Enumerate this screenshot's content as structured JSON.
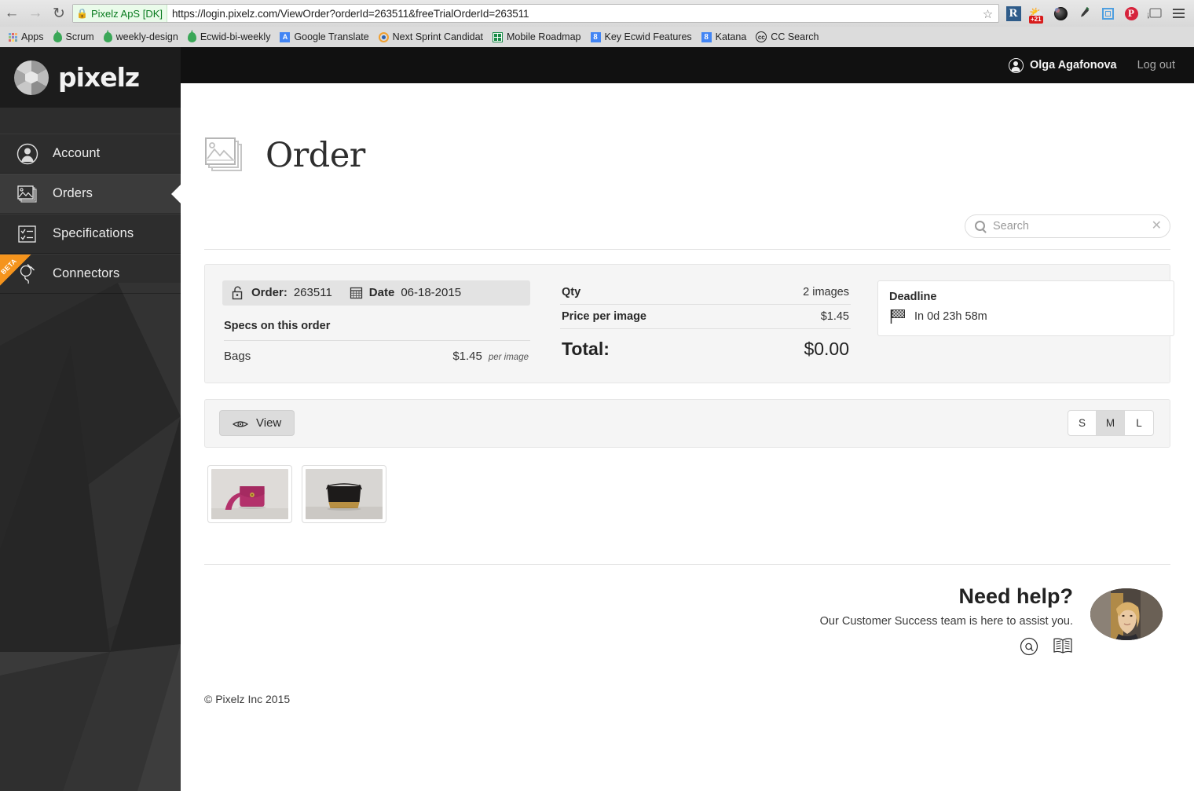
{
  "browser": {
    "back_icon": "back-arrow-icon",
    "forward_icon": "forward-arrow-icon",
    "reload_icon": "reload-icon",
    "site_chip": "Pixelz ApS [DK]",
    "url": "https://login.pixelz.com/ViewOrder?orderId=263511&freeTrialOrderId=263511",
    "star_icon": "bookmark-star-icon",
    "toolbar_icons": [
      {
        "name": "readability-extension-icon",
        "label": "R"
      },
      {
        "name": "weather-extension-icon",
        "label": "",
        "badge": "+21"
      },
      {
        "name": "camera-extension-icon",
        "label": ""
      },
      {
        "name": "eyedropper-extension-icon",
        "label": ""
      },
      {
        "name": "screenshot-extension-icon",
        "label": ""
      },
      {
        "name": "pinterest-extension-icon",
        "label": "P"
      },
      {
        "name": "cast-icon",
        "label": ""
      },
      {
        "name": "chrome-menu-icon",
        "label": ""
      }
    ],
    "bookmarks": [
      {
        "label": "Apps",
        "icon": "apps-grid-icon"
      },
      {
        "label": "Scrum",
        "icon": "green-drop-icon"
      },
      {
        "label": "weekly-design",
        "icon": "green-drop-icon"
      },
      {
        "label": "Ecwid-bi-weekly",
        "icon": "green-drop-icon"
      },
      {
        "label": "Google Translate",
        "icon": "google-translate-icon"
      },
      {
        "label": "Next Sprint Candidat",
        "icon": "target-icon"
      },
      {
        "label": "Mobile Roadmap",
        "icon": "spreadsheet-icon"
      },
      {
        "label": "Key Ecwid Features",
        "icon": "google-docs-icon"
      },
      {
        "label": "Katana",
        "icon": "google-docs-icon"
      },
      {
        "label": "CC Search",
        "icon": "creative-commons-icon"
      }
    ]
  },
  "sidebar": {
    "logo_text": "pixelz",
    "logo_icon": "pixelz-aperture-logo",
    "items": [
      {
        "label": "Account",
        "icon": "account-person-icon",
        "active": false,
        "beta": false
      },
      {
        "label": "Orders",
        "icon": "orders-images-icon",
        "active": true,
        "beta": false
      },
      {
        "label": "Specifications",
        "icon": "specifications-checklist-icon",
        "active": false,
        "beta": false
      },
      {
        "label": "Connectors",
        "icon": "connectors-plug-icon",
        "active": false,
        "beta": true,
        "beta_label": "BETA"
      }
    ]
  },
  "topbar": {
    "user_name": "Olga Agafonova",
    "user_icon": "user-avatar-icon",
    "logout_label": "Log out"
  },
  "page": {
    "title": "Order",
    "title_icon": "images-stack-icon"
  },
  "search": {
    "placeholder": "Search",
    "value": "",
    "search_icon": "search-icon",
    "clear_icon": "clear-x-icon"
  },
  "summary": {
    "order_label": "Order:",
    "order_number": "263511",
    "order_icon": "unlock-icon",
    "date_label": "Date",
    "date_value": "06-18-2015",
    "date_icon": "calendar-icon",
    "specs_title": "Specs on this order",
    "specs": [
      {
        "name": "Bags",
        "price": "$1.45",
        "unit": "per image"
      }
    ],
    "qty_label": "Qty",
    "qty_value": "2 images",
    "price_label": "Price per image",
    "price_value": "$1.45",
    "total_label": "Total:",
    "total_value": "$0.00",
    "deadline_title": "Deadline",
    "deadline_value": "In 0d 23h 58m",
    "deadline_icon": "checkered-flag-icon"
  },
  "toolbar": {
    "view_label": "View",
    "view_icon": "eye-icon",
    "sizes": [
      {
        "label": "S",
        "active": false
      },
      {
        "label": "M",
        "active": true
      },
      {
        "label": "L",
        "active": false
      }
    ]
  },
  "thumbnails": [
    {
      "name": "pink-ostrich-crossbody-bag",
      "alt": "Pink textured crossbody bag on grey backdrop"
    },
    {
      "name": "black-gold-clutch-bag",
      "alt": "Black and gold clutch bag on concrete backdrop"
    }
  ],
  "help": {
    "title": "Need help?",
    "subtitle": "Our Customer Success team is here to assist you.",
    "icons": [
      {
        "name": "email-at-icon"
      },
      {
        "name": "knowledge-base-book-icon"
      }
    ],
    "avatar_icon": "support-agent-photo"
  },
  "footer": {
    "copyright": "© Pixelz Inc 2015"
  },
  "colors": {
    "sidebar_bg": "#2b2b2b",
    "topbar_bg": "#111111",
    "accent_beta": "#f5941d",
    "card_bg": "#f5f5f5",
    "chip_green": "#0a7c20"
  }
}
